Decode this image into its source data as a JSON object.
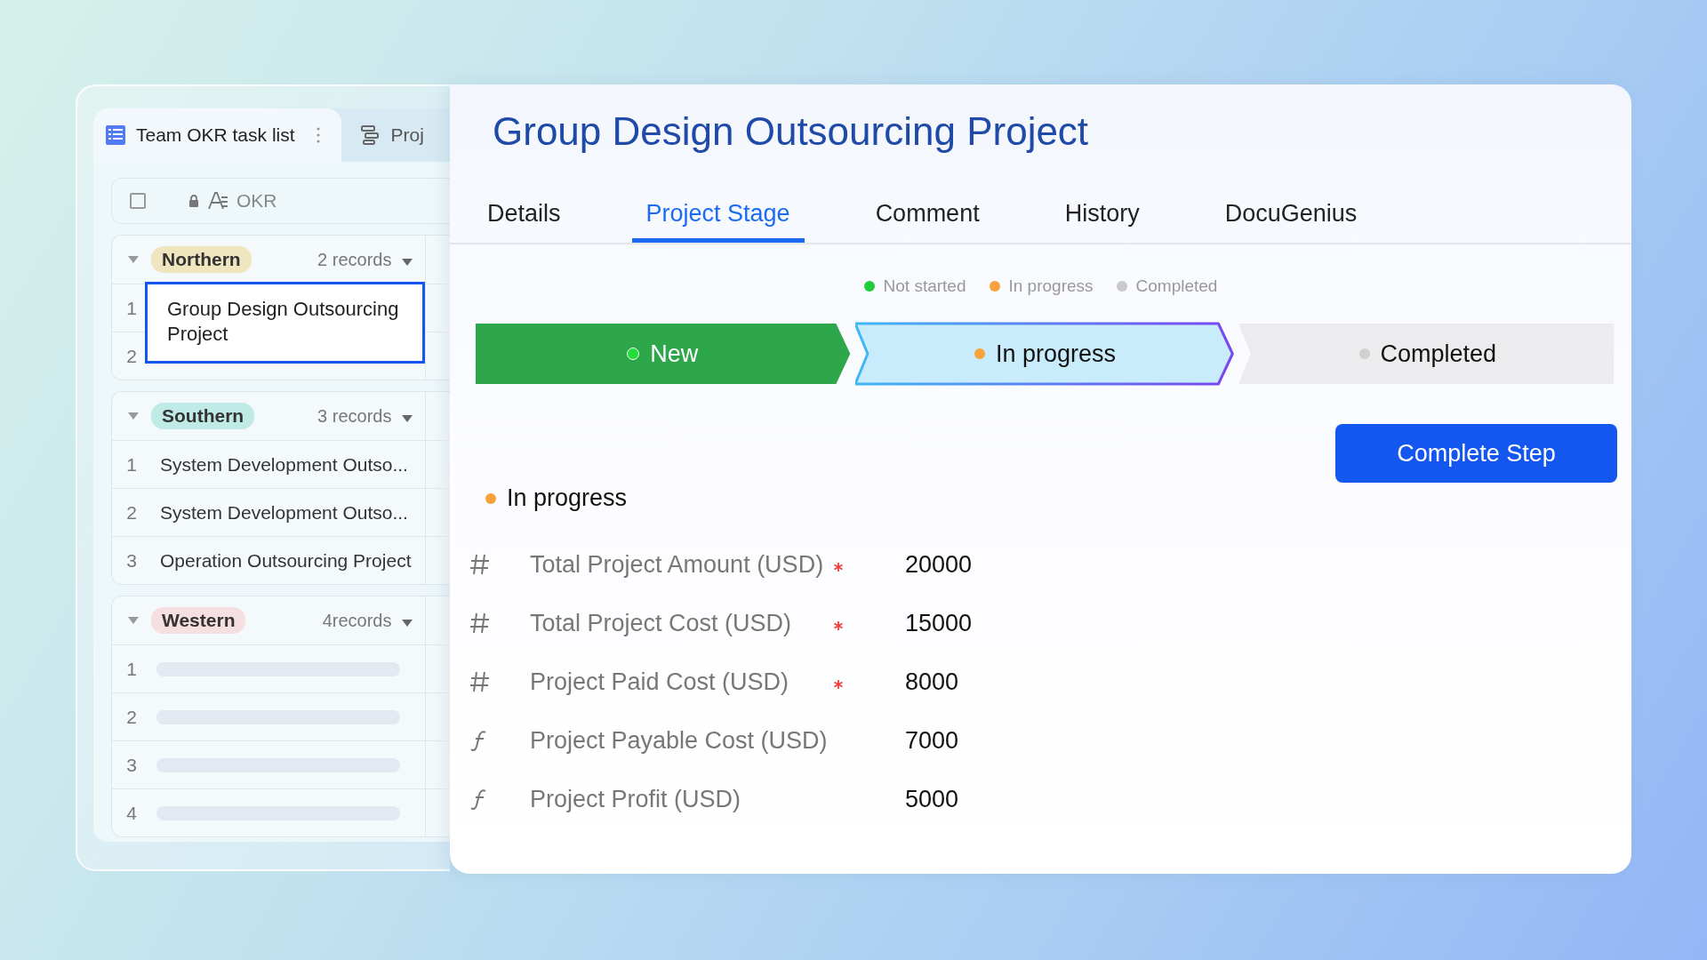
{
  "sheet": {
    "tabs": [
      {
        "label": "Team OKR task list",
        "kind": "grid",
        "selected": true
      },
      {
        "label": "Proj",
        "kind": "gantt",
        "selected": false
      }
    ],
    "header": {
      "column": "OKR",
      "checked": false
    },
    "groups": [
      {
        "name": "Northern",
        "color": "#efe6bf",
        "count": "2 records",
        "rows": [
          {
            "number": "1",
            "title": "Group Design Outsourcing Project",
            "selected": true
          },
          {
            "number": "2",
            "selected": false
          }
        ]
      },
      {
        "name": "Southern",
        "color": "#bfeae6",
        "count": "3 records",
        "rows": [
          {
            "number": "1",
            "title": "System Development Outso...",
            "selected": false
          },
          {
            "number": "2",
            "title": "System Development Outso...",
            "selected": false
          },
          {
            "number": "3",
            "title": "Operation Outsourcing Project",
            "selected": false
          }
        ]
      },
      {
        "name": "Western",
        "color": "#f5dfe0",
        "count": "4records",
        "rows": [
          {
            "number": "1",
            "kind": "placeholder",
            "selected": false
          },
          {
            "number": "2",
            "kind": "placeholder",
            "selected": false
          },
          {
            "number": "3",
            "kind": "placeholder",
            "selected": false
          },
          {
            "number": "4",
            "kind": "placeholder",
            "selected": false
          }
        ]
      }
    ]
  },
  "record": {
    "title": "Group Design Outsourcing Project",
    "tabs": [
      {
        "label": "Details",
        "selected": false
      },
      {
        "label": "Project Stage",
        "selected": true
      },
      {
        "label": "Comment",
        "selected": false
      },
      {
        "label": "History",
        "selected": false
      },
      {
        "label": "DocuGenius",
        "selected": false
      }
    ],
    "legend": [
      {
        "label": "Not started",
        "color": "#22cc3a"
      },
      {
        "label": "In progress",
        "color": "#f7a23b"
      },
      {
        "label": "Completed",
        "color": "#c9c9c9"
      }
    ],
    "stages": [
      {
        "label": "New",
        "kind": "done",
        "color": "#22dd3a"
      },
      {
        "label": "In progress",
        "kind": "current",
        "color": "#f7a23b"
      },
      {
        "label": "Completed",
        "kind": "todo",
        "color": "#cfcfcf"
      }
    ],
    "button": "Complete Step",
    "status": {
      "label": "In progress",
      "color": "#f7a23b"
    },
    "fields": [
      {
        "kind": "number",
        "label": "Total Project Amount (USD)",
        "required": true,
        "value": "20000"
      },
      {
        "kind": "number",
        "label": "Total Project Cost (USD)",
        "required": true,
        "value": "15000"
      },
      {
        "kind": "number",
        "label": "Project Paid Cost (USD)",
        "required": true,
        "value": "8000"
      },
      {
        "kind": "formula",
        "label": "Project Payable Cost (USD)",
        "required": false,
        "value": "7000"
      },
      {
        "kind": "formula",
        "label": "Project Profit (USD)",
        "required": false,
        "value": "5000"
      }
    ]
  }
}
